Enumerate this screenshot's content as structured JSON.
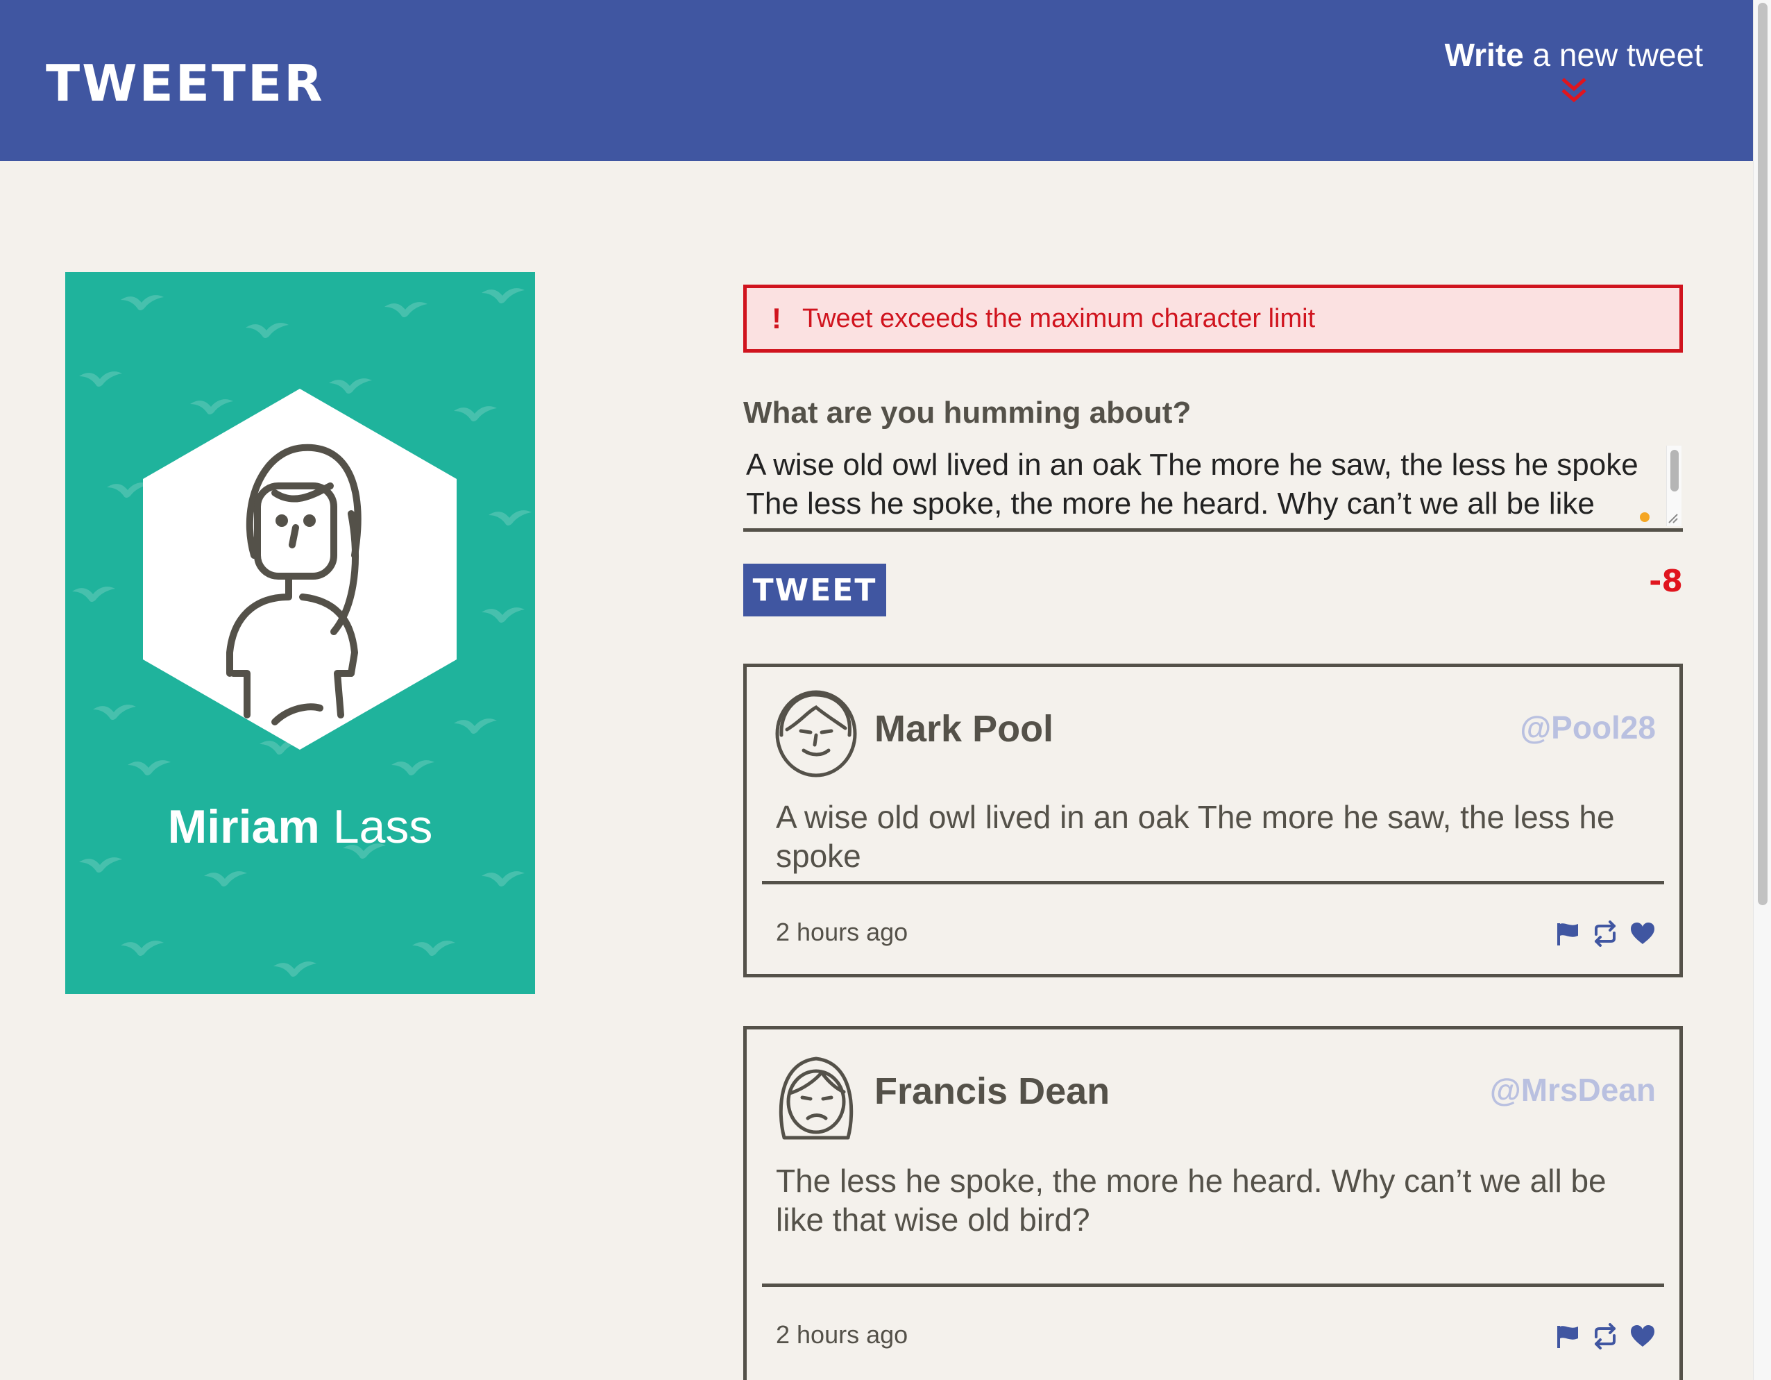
{
  "nav": {
    "brand": "TWEETER",
    "compose_bold": "Write",
    "compose_rest": " a new tweet",
    "icon": "chevron-double-down-icon"
  },
  "profile": {
    "first_name": "Miriam",
    "last_name": " Lass",
    "avatar_icon": "female-avatar-icon",
    "background_color": "#1fb39c"
  },
  "composer": {
    "error_mark": "!",
    "error_text": "Tweet exceeds the maximum character limit",
    "label": "What are you humming about?",
    "value": "A wise old owl lived in an oak The more he saw, the less he spoke The less he spoke, the more he heard. Why can’t we all be like that",
    "button": "TWEET",
    "counter": "-8"
  },
  "tweets": [
    {
      "name": "Mark Pool",
      "handle": "@Pool28",
      "content": "A wise old owl lived in an oak The more he saw, the less he spoke",
      "time": "2 hours ago",
      "avatar_icon": "male-avatar-icon"
    },
    {
      "name": "Francis Dean",
      "handle": "@MrsDean",
      "content": "The less he spoke, the more he heard. Why can’t we all be like that wise old bird?",
      "time": "2 hours ago",
      "avatar_icon": "female-avatar-icon"
    }
  ],
  "colors": {
    "nav": "#4056a1",
    "accent_red": "#d0141e",
    "text": "#545149",
    "background": "#f4f1ec",
    "handle": "#b9c0e0"
  }
}
